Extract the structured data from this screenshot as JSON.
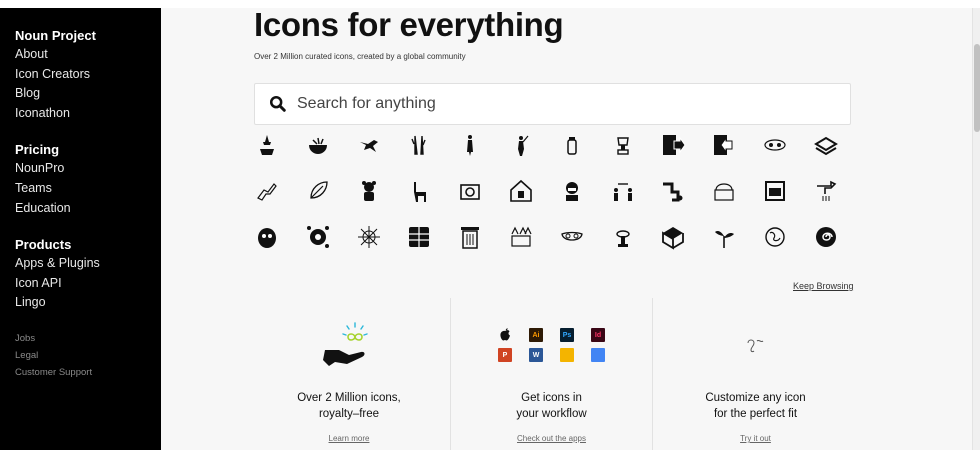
{
  "sidebar": {
    "groups": [
      {
        "head": "Noun Project",
        "links": [
          "About",
          "Icon Creators",
          "Blog",
          "Iconathon"
        ]
      },
      {
        "head": "Pricing",
        "links": [
          "NounPro",
          "Teams",
          "Education"
        ]
      },
      {
        "head": "Products",
        "links": [
          "Apps & Plugins",
          "Icon API",
          "Lingo"
        ]
      }
    ],
    "small_links": [
      "Jobs",
      "Legal",
      "Customer Support"
    ]
  },
  "hero": {
    "title": "Icons for everything",
    "subtitle": "Over 2 Million curated icons, created by a global community"
  },
  "search": {
    "placeholder": "Search for anything"
  },
  "icons": [
    [
      "plant-pot-icon",
      "bowl-icon",
      "bird-icon",
      "trees-icon",
      "woman-icon",
      "hunter-icon",
      "jar-icon",
      "trophy-icon",
      "login-icon",
      "logout-icon",
      "capsules-icon",
      "sandwich-icon"
    ],
    [
      "dragon-icon",
      "leaf-icon",
      "bear-icon",
      "llama-icon",
      "camera-icon",
      "house-icon",
      "doctor-icon",
      "distance-icon",
      "pipe-icon",
      "basket-icon",
      "stove-icon",
      "faucet-icon"
    ],
    [
      "monster-icon",
      "virus-icon",
      "spider-web-icon",
      "map-icon",
      "trash-bin-icon",
      "market-icon",
      "mask-icon",
      "fountain-icon",
      "box-icon",
      "plant-icon",
      "planet-icon",
      "spiral-icon"
    ]
  ],
  "keep_browsing": "Keep Browsing",
  "features": [
    {
      "title_line1": "Over 2 Million icons,",
      "title_line2": "royalty–free",
      "link": "Learn more"
    },
    {
      "title_line1": "Get icons in",
      "title_line2": "your workflow",
      "link": "Check out the apps"
    },
    {
      "title_line1": "Customize any icon",
      "title_line2": "for the perfect fit",
      "link": "Try it out"
    }
  ],
  "apps": [
    {
      "label": "",
      "color": "#ffffff",
      "name": "apple-icon"
    },
    {
      "label": "Ai",
      "color": "#2e1a05",
      "name": "illustrator-icon"
    },
    {
      "label": "Ps",
      "color": "#061e30",
      "name": "photoshop-icon"
    },
    {
      "label": "Id",
      "color": "#3a0716",
      "name": "indesign-icon"
    },
    {
      "label": "P",
      "color": "#d04423",
      "name": "powerpoint-icon"
    },
    {
      "label": "W",
      "color": "#2b5797",
      "name": "word-icon"
    },
    {
      "label": "",
      "color": "#f4b400",
      "name": "google-slides-icon"
    },
    {
      "label": "",
      "color": "#4285f4",
      "name": "google-docs-icon"
    }
  ],
  "colors": {
    "sidebar_bg": "#000000",
    "page_bg": "#f7f7f7",
    "accent_cyan": "#2ab7d9",
    "accent_lime": "#a6d22e"
  }
}
